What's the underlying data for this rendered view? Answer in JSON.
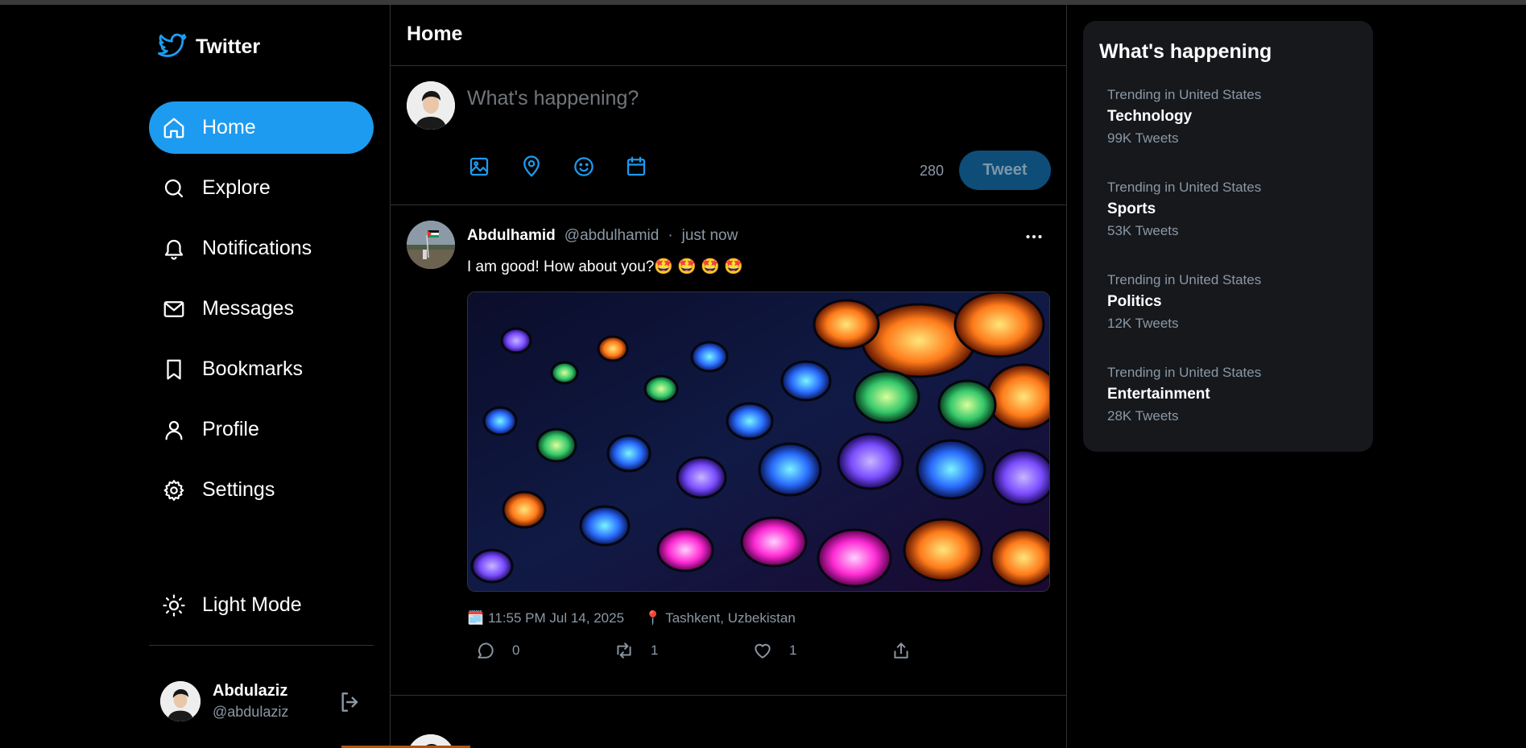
{
  "app": {
    "name": "Twitter",
    "logo_icon": "twitter-bird-icon"
  },
  "colors": {
    "accent": "#1d9bf0",
    "background": "#000000",
    "panel": "#16181c",
    "muted": "#8b98a5",
    "tweet_button_disabled": "#0e4d78"
  },
  "sidebar": {
    "items": [
      {
        "label": "Home",
        "icon": "home-icon",
        "active": true
      },
      {
        "label": "Explore",
        "icon": "search-icon",
        "active": false
      },
      {
        "label": "Notifications",
        "icon": "bell-icon",
        "active": false
      },
      {
        "label": "Messages",
        "icon": "mail-icon",
        "active": false
      },
      {
        "label": "Bookmarks",
        "icon": "bookmark-icon",
        "active": false
      },
      {
        "label": "Profile",
        "icon": "user-icon",
        "active": false
      },
      {
        "label": "Settings",
        "icon": "gear-icon",
        "active": false
      }
    ],
    "theme_toggle": {
      "label": "Light Mode",
      "icon": "sun-icon"
    },
    "current_user": {
      "name": "Abdulaziz",
      "handle": "@abdulaziz",
      "logout_icon": "logout-icon"
    }
  },
  "main": {
    "title": "Home",
    "composer": {
      "placeholder": "What's happening?",
      "tools": [
        "image-icon",
        "location-pin-icon",
        "emoji-icon",
        "calendar-icon"
      ],
      "char_count": "280",
      "submit_label": "Tweet"
    },
    "tweets": [
      {
        "name": "Abdulhamid",
        "handle": "@abdulhamid",
        "separator": "·",
        "time": "just now",
        "text": "I am good! How about you?🤩 🤩 🤩 🤩",
        "posted_at": "11:55 PM Jul 14, 2025",
        "posted_at_icon": "🗓️",
        "location": "Tashkent, Uzbekistan",
        "location_icon": "📍",
        "replies": "0",
        "retweets": "1",
        "likes": "1"
      }
    ]
  },
  "trends": {
    "title": "What's happening",
    "items": [
      {
        "context": "Trending in United States",
        "topic": "Technology",
        "count": "99K Tweets"
      },
      {
        "context": "Trending in United States",
        "topic": "Sports",
        "count": "53K Tweets"
      },
      {
        "context": "Trending in United States",
        "topic": "Politics",
        "count": "12K Tweets"
      },
      {
        "context": "Trending in United States",
        "topic": "Entertainment",
        "count": "28K Tweets"
      }
    ]
  }
}
